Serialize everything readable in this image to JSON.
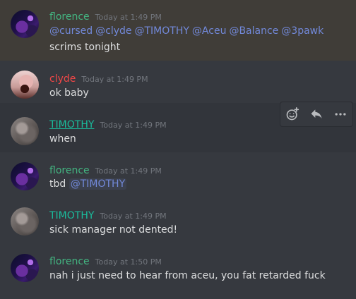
{
  "messages": [
    {
      "author": "florence",
      "timestamp": "Today at 1:49 PM",
      "mentions": [
        "@cursed",
        "@clyde",
        "@TIMOTHY",
        "@Aceu",
        "@Balance",
        "@3pawk"
      ],
      "text": "scrims tonight"
    },
    {
      "author": "clyde",
      "timestamp": "Today at 1:49 PM",
      "text": "ok baby"
    },
    {
      "author": "TIMOTHY",
      "timestamp": "Today at 1:49 PM",
      "text": "when"
    },
    {
      "author": "florence",
      "timestamp": "Today at 1:49 PM",
      "text": "tbd",
      "mention": "@TIMOTHY"
    },
    {
      "author": "TIMOTHY",
      "timestamp": "Today at 1:49 PM",
      "text": "sick manager not dented!"
    },
    {
      "author": "florence",
      "timestamp": "Today at 1:50 PM",
      "text": "nah i just need to hear from aceu, you fat retarded fuck"
    }
  ],
  "toolbar": {
    "icons": [
      "add-reaction-icon",
      "reply-icon",
      "more-options-icon"
    ]
  },
  "colors": {
    "background": "#36393f",
    "florence": "#43b581",
    "clyde": "#f04747",
    "timothy": "#1abc9c",
    "mention": "#7289da",
    "timestamp": "#72767d",
    "text": "#dcddde"
  }
}
